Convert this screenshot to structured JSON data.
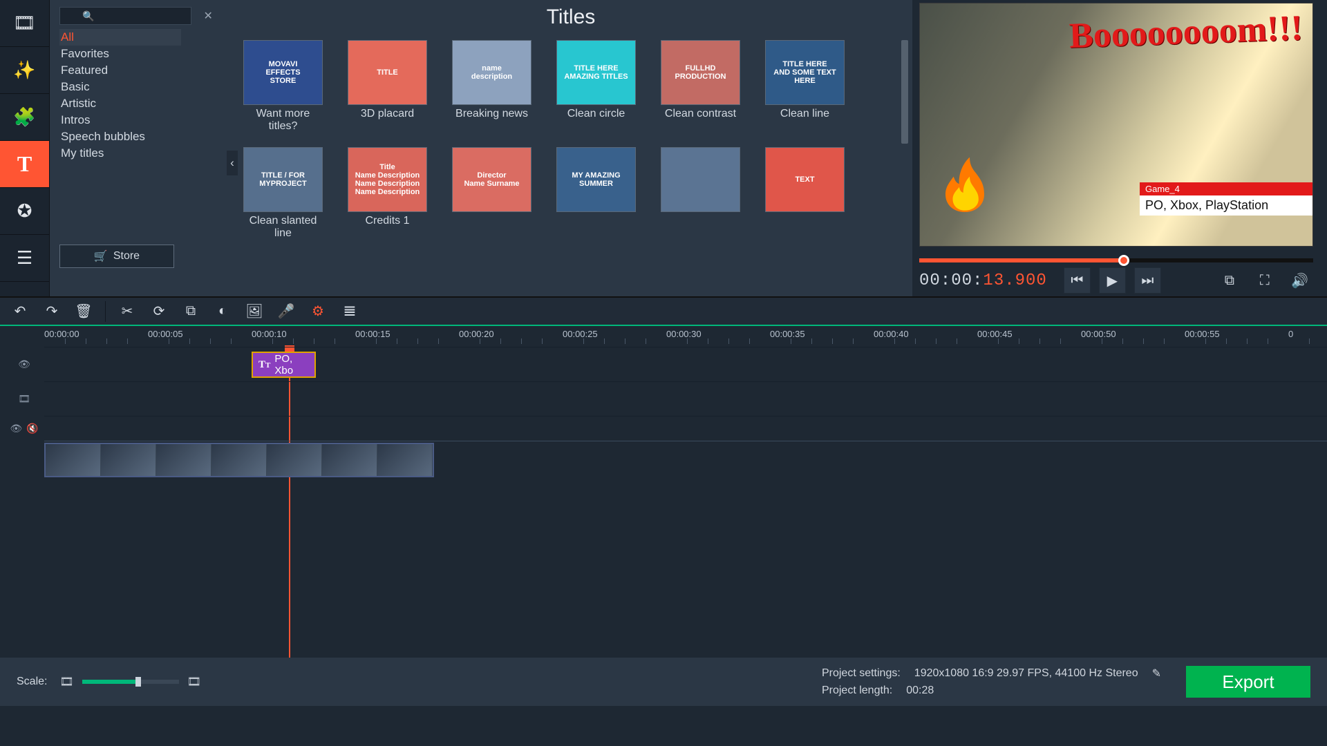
{
  "sidebar": {
    "tabs": [
      {
        "name": "media-import-tab",
        "icon": "film-icon"
      },
      {
        "name": "filters-tab",
        "icon": "wand-icon"
      },
      {
        "name": "transitions-tab",
        "icon": "puzzle-icon"
      },
      {
        "name": "titles-tab",
        "icon": "text-icon",
        "active": true
      },
      {
        "name": "stickers-tab",
        "icon": "star-badge-icon"
      },
      {
        "name": "more-tab",
        "icon": "list-icon"
      }
    ]
  },
  "browser": {
    "panel_title": "Titles",
    "search_placeholder": "",
    "categories": [
      {
        "label": "All",
        "active": true
      },
      {
        "label": "Favorites"
      },
      {
        "label": "Featured"
      },
      {
        "label": "Basic"
      },
      {
        "label": "Artistic"
      },
      {
        "label": "Intros"
      },
      {
        "label": "Speech bubbles"
      },
      {
        "label": "My titles"
      }
    ],
    "store_label": "Store",
    "tiles": [
      {
        "label": "Want more titles?",
        "thumb_text": "MOVAVI\nEFFECTS\nSTORE",
        "thumb_bg": "#2e4d8f"
      },
      {
        "label": "3D placard",
        "thumb_text": "TITLE",
        "thumb_bg": "#e46a5b"
      },
      {
        "label": "Breaking news",
        "thumb_text": "name\ndescription",
        "thumb_bg": "#8da2be"
      },
      {
        "label": "Clean circle",
        "thumb_text": "TITLE HERE\nAMAZING TITLES",
        "thumb_bg": "#28c6d0"
      },
      {
        "label": "Clean contrast",
        "thumb_text": "FULLHD  PRODUCTION",
        "thumb_bg": "#c26b64"
      },
      {
        "label": "Clean line",
        "thumb_text": "TITLE HERE\nAND SOME TEXT HERE",
        "thumb_bg": "#2f5a88"
      },
      {
        "label": "Clean slanted line",
        "thumb_text": "TITLE / FOR MYPROJECT",
        "thumb_bg": "#566f8d"
      },
      {
        "label": "Credits 1",
        "thumb_text": "Title\nName Description\nName Description\nName Description",
        "thumb_bg": "#d9665b"
      },
      {
        "label": "",
        "thumb_text": "Director\nName Surname",
        "thumb_bg": "#da6c62"
      },
      {
        "label": "",
        "thumb_text": "MY AMAZING SUMMER",
        "thumb_bg": "#39618c"
      },
      {
        "label": "",
        "thumb_text": "",
        "thumb_bg": "#5b7493"
      },
      {
        "label": "",
        "thumb_text": "TEXT",
        "thumb_bg": "#e0564a"
      }
    ]
  },
  "preview": {
    "overlay_boom": "Boooooooom!!!",
    "lower_third_top": "Game_4",
    "lower_third_bottom": "PO, Xbox, PlayStation",
    "timecode_prefix": "00:00:",
    "timecode_highlight": "13.900"
  },
  "toolbar": {
    "buttons": [
      {
        "name": "undo-button",
        "icon": "undo-icon"
      },
      {
        "name": "redo-button",
        "icon": "redo-icon"
      },
      {
        "name": "delete-button",
        "icon": "trash-icon"
      },
      {
        "sep": true
      },
      {
        "name": "cut-button",
        "icon": "scissors-icon"
      },
      {
        "name": "rotate-button",
        "icon": "rotate-icon"
      },
      {
        "name": "crop-button",
        "icon": "crop-icon"
      },
      {
        "name": "color-button",
        "icon": "contrast-icon"
      },
      {
        "name": "overlay-button",
        "icon": "image-icon"
      },
      {
        "name": "mic-record-button",
        "icon": "mic-icon"
      },
      {
        "name": "clip-properties-button",
        "icon": "gear-icon",
        "active": true
      },
      {
        "name": "equalizer-button",
        "icon": "sliders-icon"
      }
    ]
  },
  "preview_controls": {
    "buttons_left": [
      {
        "name": "prev-frame-button",
        "icon": "skip-back-icon"
      },
      {
        "name": "play-button",
        "icon": "play-icon"
      },
      {
        "name": "next-frame-button",
        "icon": "skip-forward-icon"
      }
    ],
    "buttons_right": [
      {
        "name": "detach-preview-button",
        "icon": "popout-icon"
      },
      {
        "name": "fullscreen-button",
        "icon": "fullscreen-icon"
      },
      {
        "name": "volume-button",
        "icon": "volume-icon"
      }
    ]
  },
  "timeline": {
    "ticks": [
      "00:00:00",
      "00:00:05",
      "00:00:10",
      "00:00:15",
      "00:00:20",
      "00:00:25",
      "00:00:30",
      "00:00:35",
      "00:00:40",
      "00:00:45",
      "00:00:50",
      "00:00:55",
      "0"
    ],
    "playhead_seconds": 11.8,
    "title_clip": {
      "label": "PO, Xbo",
      "start": 10,
      "end": 13.1
    },
    "video_clip_count": 7
  },
  "status": {
    "scale_label": "Scale:",
    "settings_label": "Project settings:",
    "settings_value": "1920x1080 16:9 29.97 FPS, 44100 Hz Stereo",
    "length_label": "Project length:",
    "length_value": "00:28",
    "export_label": "Export"
  }
}
